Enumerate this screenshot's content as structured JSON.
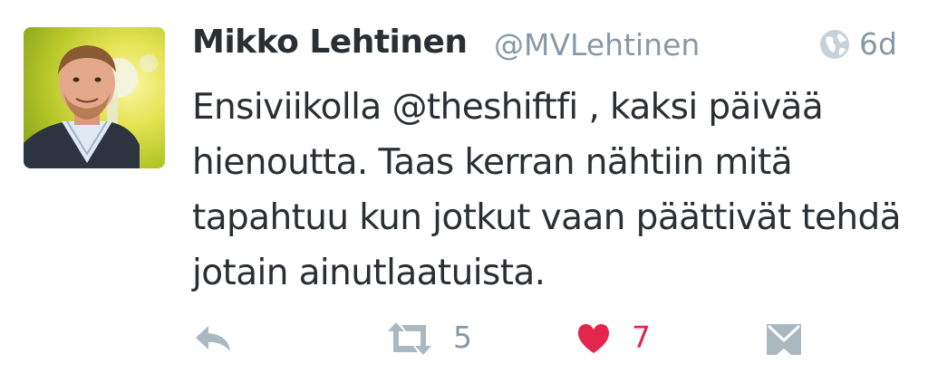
{
  "tweet": {
    "author_name": "Mikko Lehtinen",
    "handle": "@MVLehtinen",
    "time": "6d",
    "text": "Ensiviikolla @theshiftfi , kaksi päivää hienoutta. Taas kerran nähtiin mitä tapahtuu kun jotkut vaan päättivät tehdä jotain ainutlaatuista.",
    "retweet_count": "5",
    "like_count": "7",
    "liked": true
  },
  "icons": {
    "visibility": "globe-icon",
    "reply": "reply-icon",
    "retweet": "retweet-icon",
    "like": "heart-icon",
    "message": "envelope-icon"
  },
  "colors": {
    "name": "#292f33",
    "secondary": "#8899a6",
    "like": "#e2264d",
    "icon": "#aab8c2"
  }
}
